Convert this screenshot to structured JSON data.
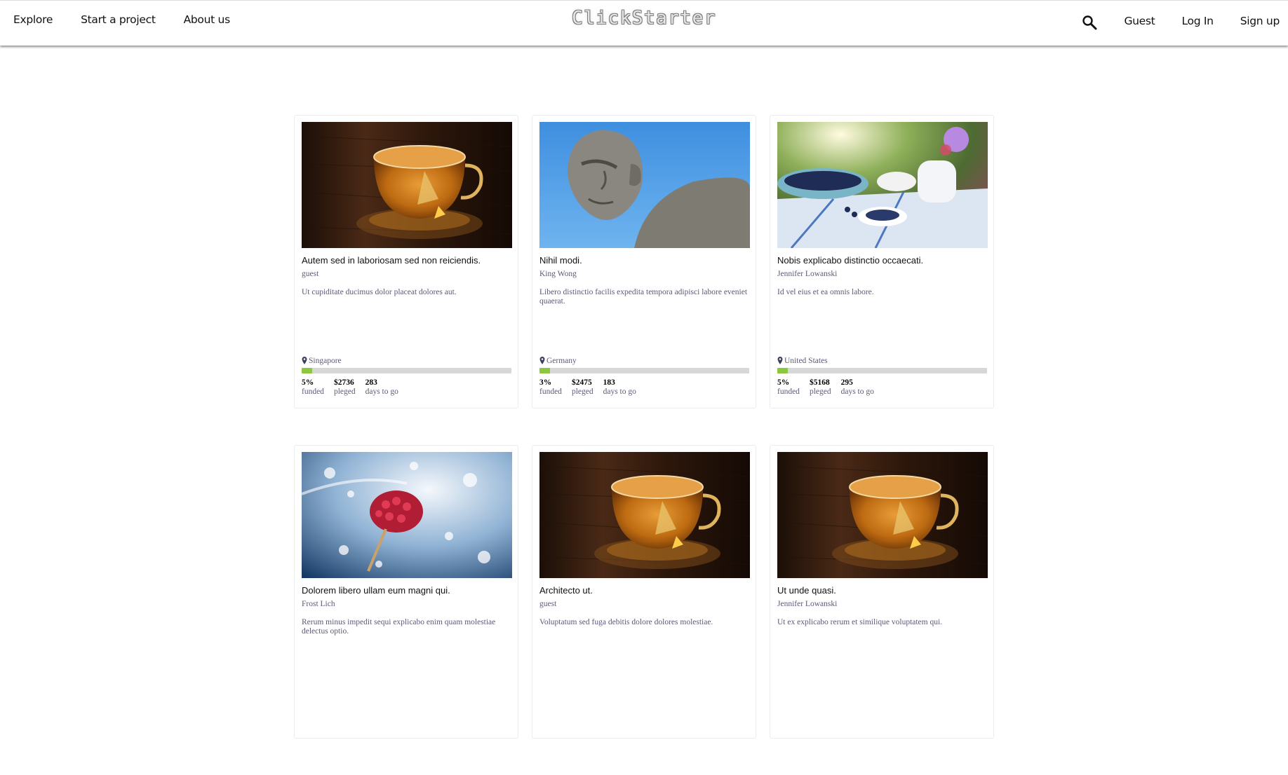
{
  "nav": {
    "explore": "Explore",
    "start_project": "Start a project",
    "about": "About us",
    "brand": "ClickStarter",
    "guest": "Guest",
    "login": "Log In",
    "signup": "Sign up"
  },
  "stat_labels": {
    "funded": "funded",
    "pledged": "pleged",
    "days": "days to go"
  },
  "projects": [
    {
      "image": "tea-cup",
      "title": "Autem sed in laboriosam sed non reiciendis.",
      "author": "guest",
      "blurb": "Ut cupiditate ducimus dolor placeat dolores aut.",
      "location": "Singapore",
      "percent": "5%",
      "pledged": "$2736",
      "days": "283",
      "progress": 0.05
    },
    {
      "image": "statue",
      "title": "Nihil modi.",
      "author": "King Wong",
      "blurb": "Libero distinctio facilis expedita tempora adipisci labore eveniet quaerat.",
      "location": "Germany",
      "percent": "3%",
      "pledged": "$2475",
      "days": "183",
      "progress": 0.03
    },
    {
      "image": "blueberries",
      "title": "Nobis explicabo distinctio occaecati.",
      "author": "Jennifer Lowanski",
      "blurb": "Id vel eius et ea omnis labore.",
      "location": "United States",
      "percent": "5%",
      "pledged": "$5168",
      "days": "295",
      "progress": 0.05
    },
    {
      "image": "raspberry-water",
      "title": "Dolorem libero ullam eum magni qui.",
      "author": "Frost Lich",
      "blurb": "Rerum minus impedit sequi explicabo enim quam molestiae delectus optio."
    },
    {
      "image": "tea-cup",
      "title": "Architecto ut.",
      "author": "guest",
      "blurb": "Voluptatum sed fuga debitis dolore dolores molestiae."
    },
    {
      "image": "tea-cup",
      "title": "Ut unde quasi.",
      "author": "Jennifer Lowanski",
      "blurb": "Ut ex explicabo rerum et similique voluptatem qui."
    }
  ],
  "colors": {
    "progress_fill": "#8dc63f",
    "progress_track": "#d7d7d7",
    "muted_text": "#5a5a78"
  }
}
